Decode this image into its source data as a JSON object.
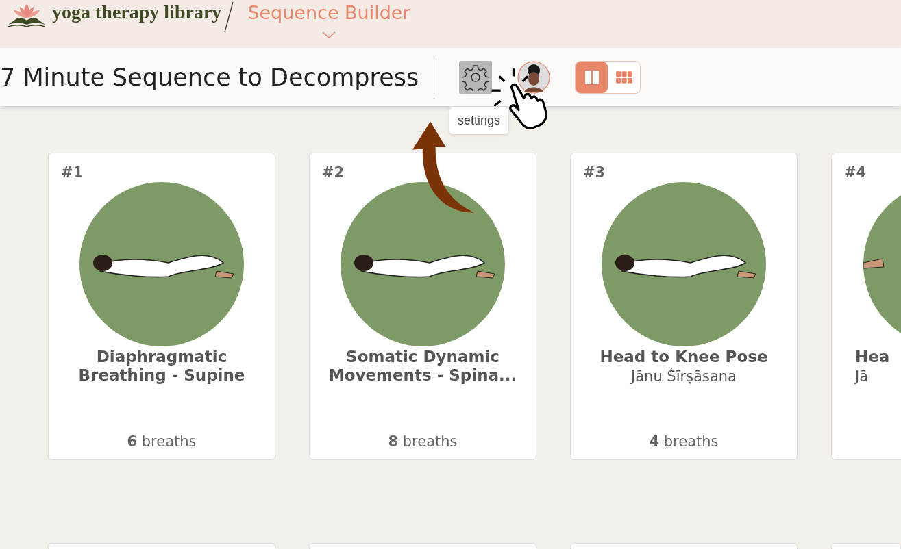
{
  "header": {
    "brand": "yoga therapy library",
    "section": "Sequence Builder"
  },
  "toolbar": {
    "title": "7 Minute Sequence to Decompress",
    "settings_tooltip": "settings",
    "view_modes": [
      {
        "kind": "columns",
        "selected": true
      },
      {
        "kind": "grid",
        "selected": false
      }
    ]
  },
  "cards": [
    {
      "kind": "full",
      "number": "#1",
      "name": "Diaphragmatic Breathing - Supine",
      "breaths": "**6** breaths"
    },
    {
      "kind": "full",
      "number": "#2",
      "name": "Somatic Dynamic Movements - Spina...",
      "breaths": "**8** breaths"
    },
    {
      "kind": "full",
      "number": "#3",
      "name": "Head to Knee Pose",
      "sanskrit": "Jānu Śīrṣāsana",
      "breaths": "**4** breaths"
    },
    {
      "kind": "partial",
      "number": "#4",
      "name": "Hea",
      "sanskrit": "Jā"
    }
  ]
}
